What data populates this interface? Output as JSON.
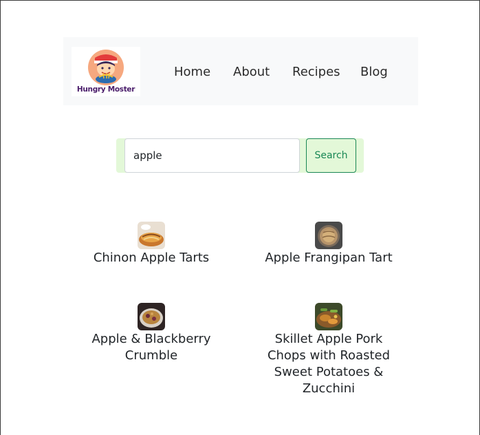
{
  "brand": {
    "logo_text": "Hungry Moster"
  },
  "nav": {
    "items": [
      {
        "label": "Home"
      },
      {
        "label": "About"
      },
      {
        "label": "Recipes"
      },
      {
        "label": "Blog"
      }
    ]
  },
  "search": {
    "value": "apple",
    "button_label": "Search"
  },
  "results": [
    {
      "title": "Chinon Apple Tarts"
    },
    {
      "title": "Apple Frangipan Tart"
    },
    {
      "title": "Apple & Blackberry Crumble"
    },
    {
      "title": "Skillet Apple Pork Chops with Roasted Sweet Potatoes & Zucchini"
    }
  ],
  "colors": {
    "navbar_bg": "#f8f9fa",
    "search_bg": "#e3f8d8",
    "accent_green": "#198754",
    "text": "#212529"
  }
}
